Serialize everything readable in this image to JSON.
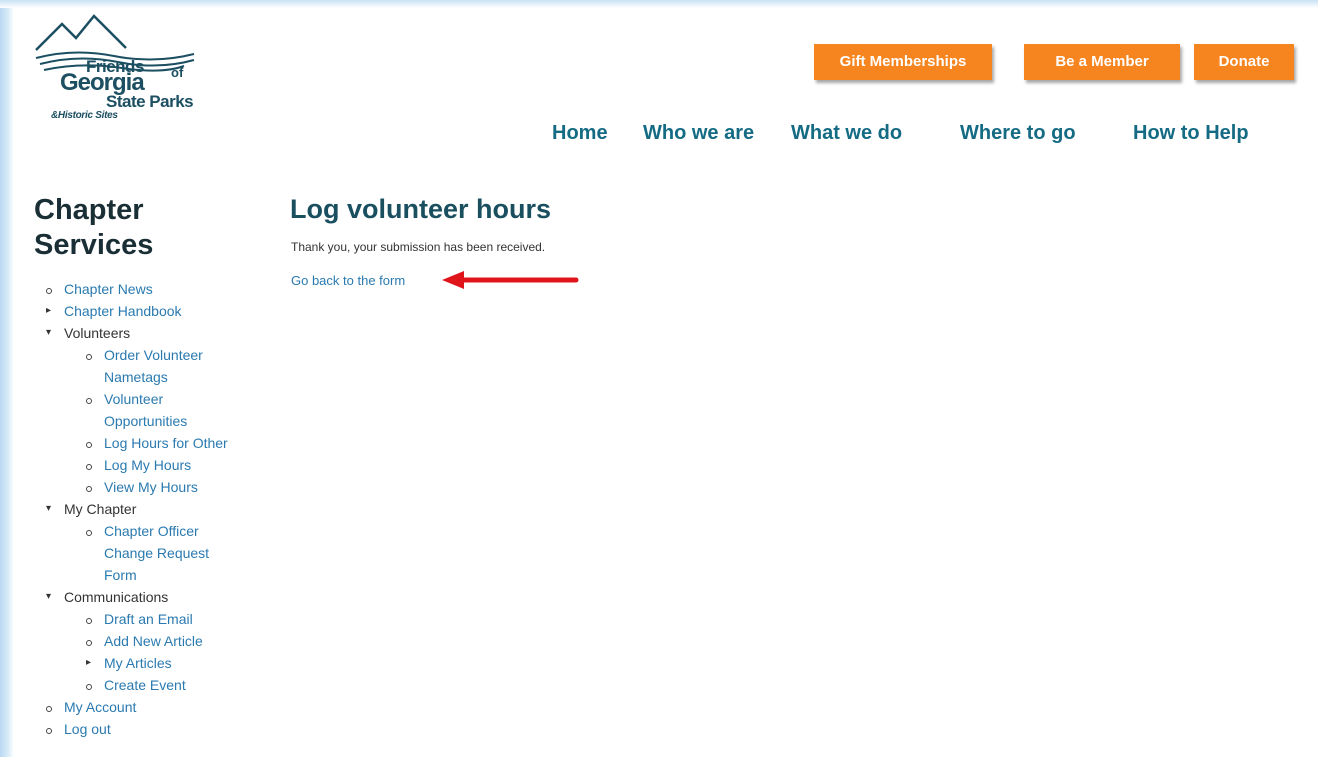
{
  "logo": {
    "friends": "Friends",
    "of": "of",
    "georgia": "Georgia",
    "state_parks": "State Parks",
    "historic_sites": "&Historic Sites"
  },
  "header": {
    "buttons": {
      "gift": "Gift Memberships",
      "member": "Be a Member",
      "donate": "Donate"
    }
  },
  "nav": {
    "home": "Home",
    "who": "Who we are",
    "what": "What we do",
    "where": "Where to go",
    "help": "How to Help"
  },
  "sidebar": {
    "title_line1": "Chapter",
    "title_line2": "Services",
    "chapter_news": "Chapter News",
    "chapter_handbook": "Chapter Handbook",
    "volunteers": "Volunteers",
    "order_nametags_1": "Order Volunteer",
    "order_nametags_2": "Nametags",
    "vol_opps_1": "Volunteer",
    "vol_opps_2": "Opportunities",
    "log_other": "Log Hours for Other",
    "log_my": "Log My Hours",
    "view_my": "View My Hours",
    "my_chapter": "My Chapter",
    "officer_1": "Chapter Officer",
    "officer_2": "Change Request",
    "officer_3": "Form",
    "communications": "Communications",
    "draft_email": "Draft an Email",
    "add_article": "Add New Article",
    "my_articles": "My Articles",
    "create_event": "Create Event",
    "my_account": "My Account",
    "log_out": "Log out"
  },
  "content": {
    "title": "Log volunteer hours",
    "message": "Thank you, your submission has been received.",
    "back_link": "Go back to the form"
  },
  "colors": {
    "orange": "#f7851f",
    "nav_teal": "#146b83",
    "link_blue": "#2a7ab0",
    "arrow_red": "#e0151b"
  }
}
